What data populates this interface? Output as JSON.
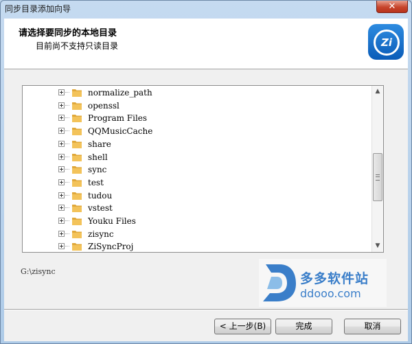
{
  "window": {
    "title": "同步目录添加向导",
    "close_label": "✕"
  },
  "header": {
    "title": "请选择要同步的本地目录",
    "subtitle": "目前尚不支持只读目录",
    "logo_text": "Zi"
  },
  "tree": {
    "items": [
      {
        "label": "normalize_path"
      },
      {
        "label": "openssl"
      },
      {
        "label": "Program Files"
      },
      {
        "label": "QQMusicCache"
      },
      {
        "label": "share"
      },
      {
        "label": "shell"
      },
      {
        "label": "sync"
      },
      {
        "label": "test"
      },
      {
        "label": "tudou"
      },
      {
        "label": "vstest"
      },
      {
        "label": "Youku Files"
      },
      {
        "label": "zisync"
      },
      {
        "label": "ZiSyncProj"
      }
    ]
  },
  "selected_path": "G:\\zisync",
  "watermark": {
    "name": "多多软件站",
    "url": "ddooo.com"
  },
  "buttons": {
    "back": "< 上一步(B)",
    "finish": "完成",
    "cancel": "取消"
  },
  "colors": {
    "folder": "#f3c35a",
    "logo": "#0a6fd0",
    "watermark": "#3a7ec9"
  }
}
